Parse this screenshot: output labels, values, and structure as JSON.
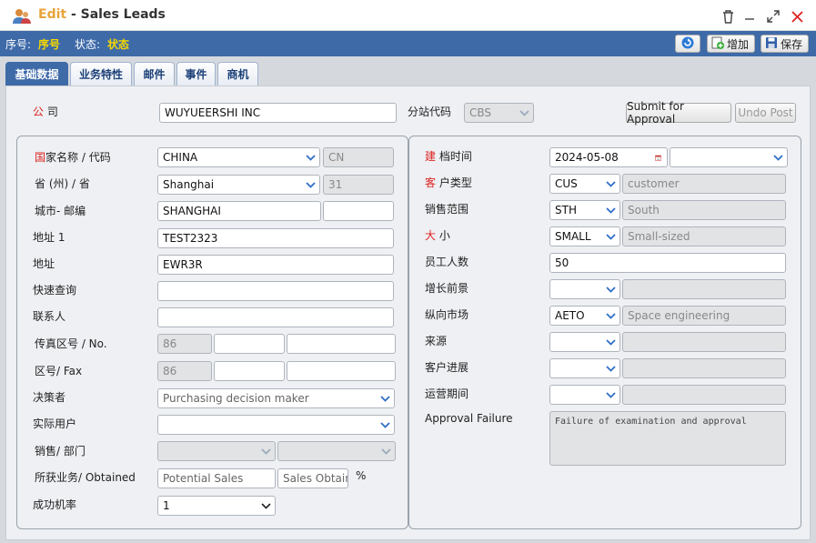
{
  "window": {
    "title_edit": "Edit",
    "title_sep": " - ",
    "title_name": "Sales Leads"
  },
  "infobar": {
    "seq_label": "序号:",
    "seq_value": "序号",
    "status_label": "状态:",
    "status_value": "状态",
    "add_label": "增加",
    "save_label": "保存"
  },
  "tabs": [
    {
      "label": "基础数据"
    },
    {
      "label": "业务特性"
    },
    {
      "label": "邮件"
    },
    {
      "label": "事件"
    },
    {
      "label": "商机"
    }
  ],
  "top": {
    "company_label_req": "公",
    "company_label_rest": "司",
    "company_value": "WUYUEERSHI INC",
    "site_label": "分站代码",
    "site_value": "CBS",
    "submit_label": "Submit for Approval",
    "undo_label": "Undo Post"
  },
  "left": {
    "country_label_req": "国",
    "country_label_rest": "家名称 / 代码",
    "country_value": "CHINA",
    "country_code": "CN",
    "province_label": "省 (州) / 省",
    "province_value": "Shanghai",
    "province_code": "31",
    "city_label": "城市- 邮编",
    "city_value": "SHANGHAI",
    "zip_value": "",
    "addr1_label": "地址 1",
    "addr1_value": "TEST2323",
    "addr_label": "地址",
    "addr_value": "EWR3R",
    "quick_label": "快速查询",
    "contact_label": "联系人",
    "fax_label": "传真区号 / No.",
    "fax_code": "86",
    "area_label": "区号/ Fax",
    "area_code": "86",
    "decision_label": "决策者",
    "decision_placeholder": "Purchasing decision maker",
    "actual_label": "实际用户",
    "sales_dept_label": "销售/ 部门",
    "obtained_label": "所获业务/ Obtained",
    "potential_placeholder": "Potential Sales",
    "obtained_placeholder": "Sales Obtained",
    "percent": "%",
    "success_label": "成功机率",
    "success_value": "1"
  },
  "right": {
    "created_label_req": "建",
    "created_label_rest": "档时间",
    "created_date": "2024-05-08",
    "cust_type_label_req": "客",
    "cust_type_label_rest": "户类型",
    "cust_type_code": "CUS",
    "cust_type_desc": "customer",
    "sales_range_label": "销售范围",
    "sales_range_code": "STH",
    "sales_range_desc": "South",
    "size_label_req": "大",
    "size_label_rest": "小",
    "size_code": "SMALL",
    "size_desc": "Small-sized",
    "employees_label": "员工人数",
    "employees_value": "50",
    "growth_label": "增长前景",
    "vertical_label": "纵向市场",
    "vertical_code": "AETO",
    "vertical_desc": "Space engineering",
    "source_label": "来源",
    "progress_label": "客户进展",
    "ops_label": "运营期间",
    "failure_label": "Approval Failure",
    "failure_text": "Failure of examination and approval"
  },
  "colors": {
    "accent": "#3e6aa8",
    "title_edit": "#e8a33a",
    "infobar_value": "#f5d800",
    "required": "#dd2222"
  }
}
